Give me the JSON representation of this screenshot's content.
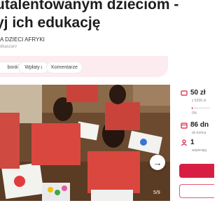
{
  "header": {
    "title_line1": "utalentowanym dzieciom -",
    "title_line2": "yj ich edukację",
    "org_name": "A DZIECI AFRYKI",
    "org_sub": "dkaszarv"
  },
  "tabs": [
    {
      "label": "bonki"
    },
    {
      "label": "Wpłaty",
      "count": "1"
    },
    {
      "label": "Komentarze"
    }
  ],
  "gallery": {
    "counter": "5/9"
  },
  "stats": {
    "raised": "50 zł",
    "raised_sub": "z 5200 zł",
    "percent": "0%",
    "progress_fraction": 0.01,
    "days": "86 dn",
    "days_sub": "do końca",
    "supporters": "1",
    "supporters_sub": "wspierają"
  },
  "colors": {
    "accent": "#d81f43",
    "tabs_bg": "#fdecef"
  }
}
